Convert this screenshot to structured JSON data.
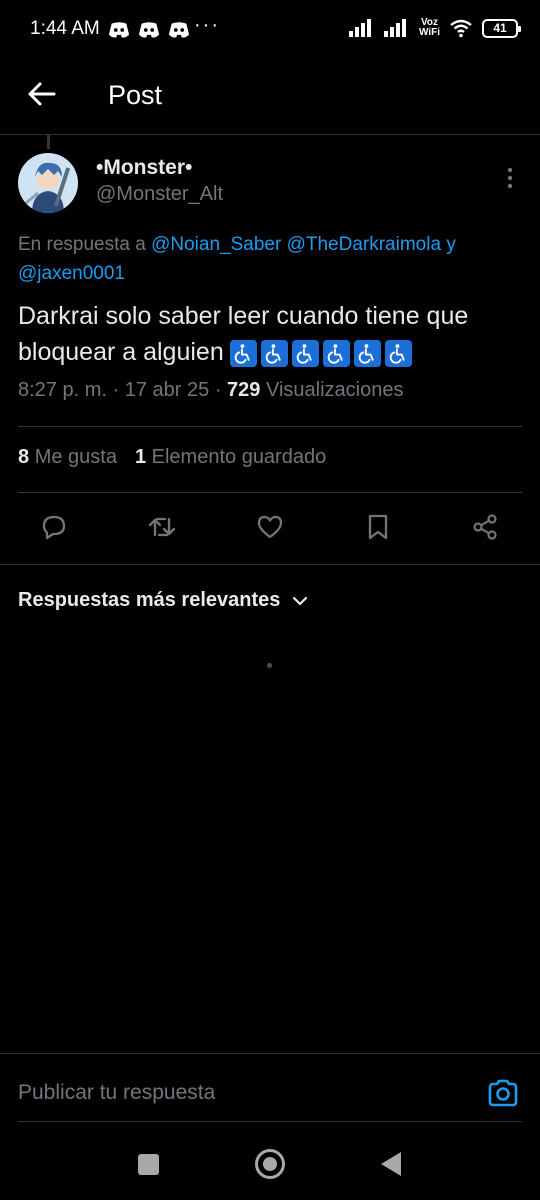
{
  "status_bar": {
    "time": "1:44 AM",
    "more": "···",
    "network_label_top": "Voz",
    "network_label_bottom": "WiFi",
    "battery": "41"
  },
  "header": {
    "title": "Post"
  },
  "post": {
    "display_name": "•Monster•",
    "handle": "@Monster_Alt",
    "reply_prefix": "En respuesta a",
    "mentions": [
      "@Noian_Saber",
      "@TheDarkraimola",
      "@jaxen0001"
    ],
    "mentions_joiner": "y",
    "text": "Darkrai solo saber leer cuando tiene que bloquear a alguien",
    "emoji": "wheelchair-emoji",
    "emoji_count": 6,
    "time": "8:27 p. m.",
    "date": "17 abr 25",
    "views_count": "729",
    "views_label": "Visualizaciones",
    "likes_count": "8",
    "likes_label": "Me gusta",
    "saves_count": "1",
    "saves_label": "Elemento guardado"
  },
  "actions": [
    "reply-icon",
    "repost-icon",
    "like-icon",
    "bookmark-icon",
    "share-icon"
  ],
  "replies": {
    "sort_label": "Respuestas más relevantes"
  },
  "composer": {
    "placeholder": "Publicar tu respuesta"
  },
  "colors": {
    "accent": "#1d9bf0",
    "background": "#000000",
    "muted": "#71767b",
    "divider": "#2f3336"
  }
}
